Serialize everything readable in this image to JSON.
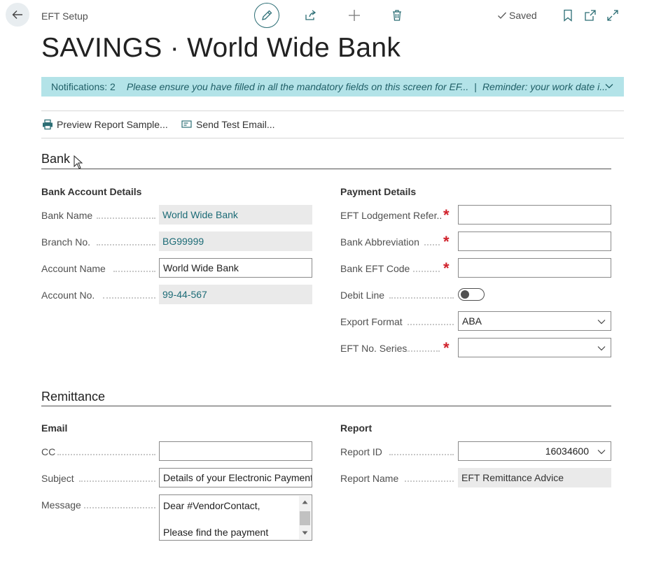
{
  "header": {
    "breadcrumb": "EFT Setup",
    "title": "SAVINGS · World Wide Bank",
    "saved_label": "Saved"
  },
  "notification": {
    "count": "Notifications: 2",
    "message1": "Please ensure you have filled in all the mandatory fields on this screen for EF...",
    "separator": "|",
    "message2": "Reminder: your work date i..."
  },
  "actions": {
    "preview": "Preview Report Sample...",
    "send_test": "Send Test Email..."
  },
  "bank": {
    "section_title": "Bank",
    "account_details": {
      "title": "Bank Account Details",
      "bank_name_label": "Bank Name",
      "bank_name_value": "World Wide Bank",
      "branch_label": "Branch No.",
      "branch_value": "BG99999",
      "account_name_label": "Account Name",
      "account_name_value": "World Wide Bank",
      "account_no_label": "Account No.",
      "account_no_value": "99-44-567"
    },
    "payment_details": {
      "title": "Payment Details",
      "lodgement_label": "EFT Lodgement Refer...",
      "lodgement_value": "",
      "abbrev_label": "Bank Abbreviation",
      "abbrev_value": "",
      "eft_code_label": "Bank EFT Code",
      "eft_code_value": "",
      "debit_line_label": "Debit Line",
      "export_format_label": "Export Format",
      "export_format_value": "ABA",
      "no_series_label": "EFT No. Series",
      "no_series_value": ""
    }
  },
  "remittance": {
    "section_title": "Remittance",
    "email": {
      "title": "Email",
      "cc_label": "CC",
      "cc_value": "",
      "subject_label": "Subject",
      "subject_value": "Details of your Electronic Payment",
      "message_label": "Message",
      "message_line1": "Dear #VendorContact,",
      "message_line2": "Please find the payment"
    },
    "report": {
      "title": "Report",
      "report_id_label": "Report ID",
      "report_id_value": "16034600",
      "report_name_label": "Report Name",
      "report_name_value": "EFT Remittance Advice"
    }
  },
  "colors": {
    "accent": "#2c6e75",
    "notification_bg": "#b3e3e8",
    "required": "#d0202a"
  }
}
